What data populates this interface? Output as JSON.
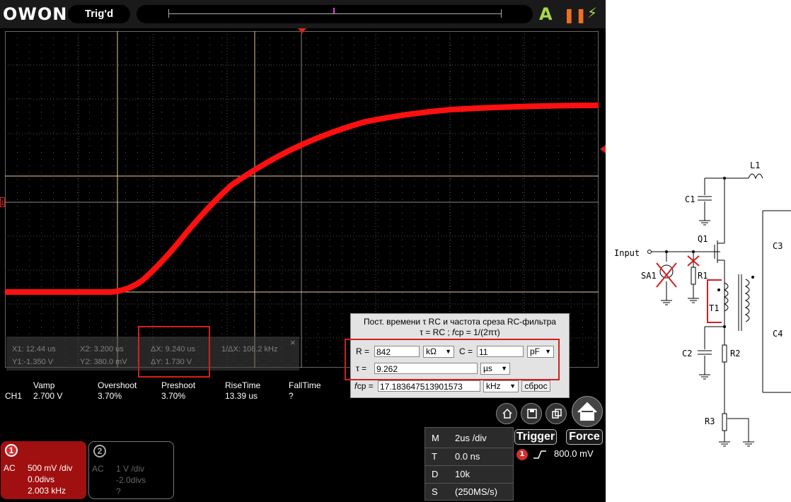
{
  "brand": {
    "logo": "OWON"
  },
  "topbar": {
    "status": "Trig'd",
    "auto_icon": "A",
    "pause_icon": "❚❚",
    "power_icon": "⚡"
  },
  "cursors": {
    "x1": "X1: 12.44 us",
    "x2": "X2: 3.200 us",
    "dx": "ΔX: 9.240 us",
    "inv_dx": "1/ΔX: 108.2 kHz",
    "y1": "Y1:-1.350 V",
    "y2": "Y2: 380.0 mV",
    "dy": "ΔY: 1.730 V",
    "close": "×"
  },
  "measurements": {
    "headers": [
      "Vamp",
      "Overshoot",
      "Preshoot",
      "RiseTime",
      "FallTime"
    ],
    "channel": "CH1",
    "values": [
      "2.700 V",
      "3.70%",
      "3.70%",
      "13.39 us",
      "?"
    ]
  },
  "rc_calculator": {
    "title_line1": "Пост. времени τ RC и частота среза RC-фильтра",
    "title_line2": "τ = RC ;   𝑓ср = 1/(2πτ)",
    "r_label": "R =",
    "r_value": "842",
    "r_unit": "kΩ",
    "c_label": "C =",
    "c_value": "11",
    "c_unit": "pF",
    "tau_label": "τ  =",
    "tau_value": "9.262",
    "tau_unit": "µs",
    "f_label": "𝑓ср =",
    "f_value": "17.183647513901573",
    "f_unit": "kHz",
    "reset_label": "сброс"
  },
  "channel1": {
    "num": "1",
    "coupling": "AC",
    "scale": "500 mV /div",
    "offset": "0.0divs",
    "freq": "2.003 kHz"
  },
  "channel2": {
    "num": "2",
    "coupling": "AC",
    "scale": "1 V /div",
    "offset": "-2.0divs",
    "freq": "?"
  },
  "horizontal": {
    "rows": [
      {
        "key": "M",
        "value": "2us /div"
      },
      {
        "key": "T",
        "value": "0.0 ns"
      },
      {
        "key": "D",
        "value": "10k"
      },
      {
        "key": "S",
        "value": "(250MS/s)"
      }
    ]
  },
  "trigger": {
    "trigger_label": "Trigger",
    "force_label": "Force",
    "source": "1",
    "level": "800.0 mV"
  },
  "markers": {
    "ch1_marker": "1"
  },
  "schematic": {
    "labels": [
      "Input",
      "SA1",
      "R1",
      "Q1",
      "C1",
      "L1",
      "T1",
      "C2",
      "R2",
      "R3",
      "C3",
      "C4"
    ]
  }
}
